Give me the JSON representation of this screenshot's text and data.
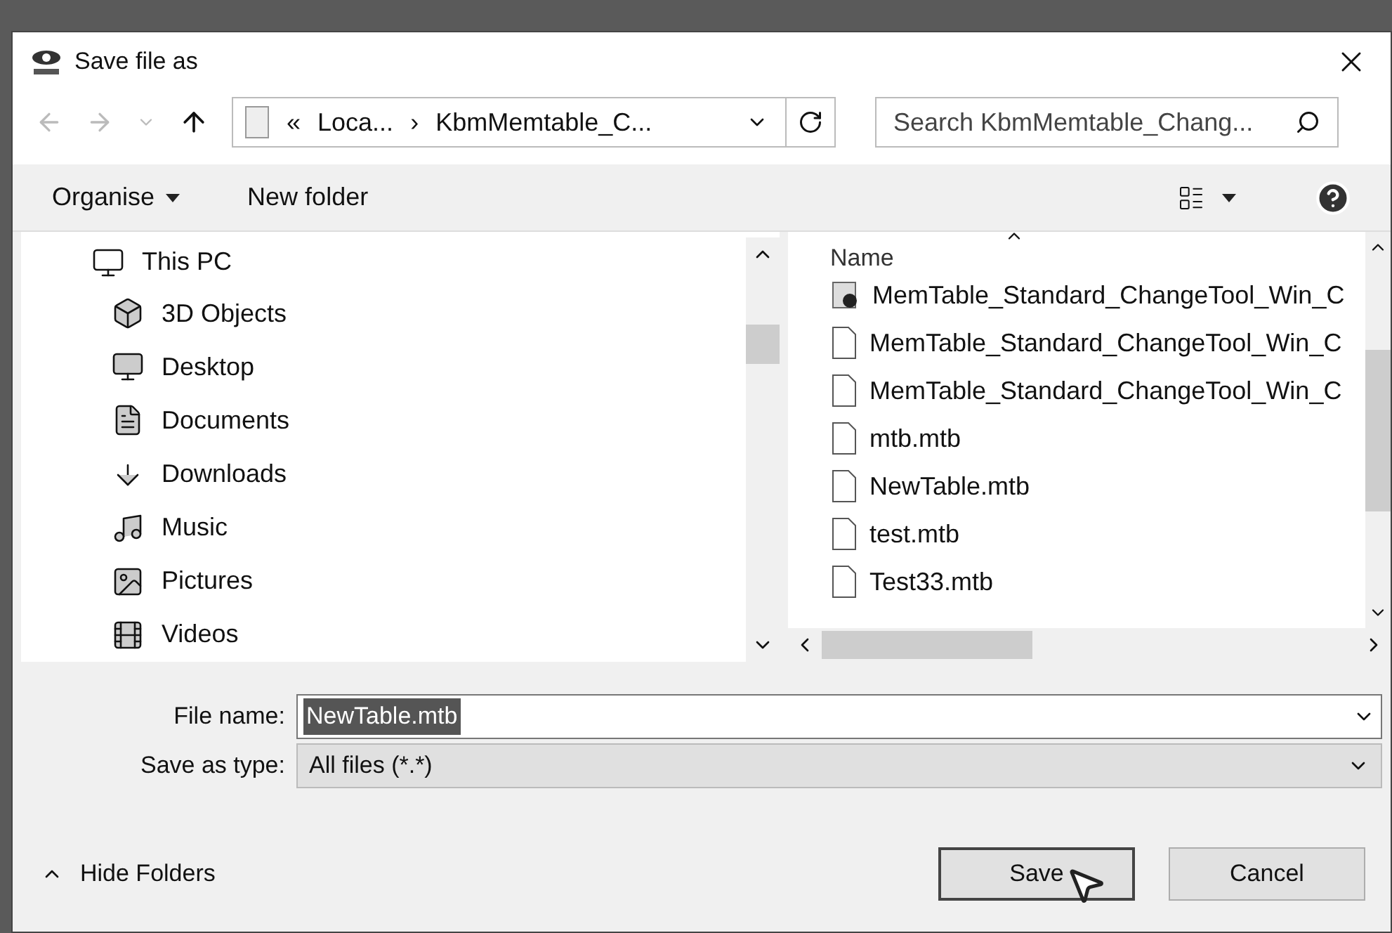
{
  "window": {
    "title": "Save file as"
  },
  "address_bar": {
    "crumbs": [
      "«",
      "Loca...",
      "›",
      "KbmMemtable_C..."
    ]
  },
  "search": {
    "placeholder": "Search KbmMemtable_Chang..."
  },
  "toolbar": {
    "organise": "Organise",
    "new_folder": "New folder"
  },
  "nav_tree": [
    {
      "label": "This PC",
      "children": [
        {
          "label": "3D Objects"
        },
        {
          "label": "Desktop"
        },
        {
          "label": "Documents"
        },
        {
          "label": "Downloads"
        },
        {
          "label": "Music"
        },
        {
          "label": "Pictures"
        },
        {
          "label": "Videos"
        }
      ]
    }
  ],
  "file_list": {
    "column": "Name",
    "files": [
      {
        "name": "MemTable_Standard_ChangeTool_Win_C",
        "kind": "image"
      },
      {
        "name": "MemTable_Standard_ChangeTool_Win_C",
        "kind": "document"
      },
      {
        "name": "MemTable_Standard_ChangeTool_Win_C",
        "kind": "document"
      },
      {
        "name": "mtb.mtb",
        "kind": "document"
      },
      {
        "name": "NewTable.mtb",
        "kind": "document"
      },
      {
        "name": "test.mtb",
        "kind": "document"
      },
      {
        "name": "Test33.mtb",
        "kind": "document"
      }
    ]
  },
  "file_name": {
    "label": "File name:",
    "value": "NewTable.mtb",
    "highlighted": true
  },
  "save_type": {
    "label": "Save as type:",
    "value": "All files (*.*)"
  },
  "hide_folders": "Hide Folders",
  "buttons": [
    {
      "label": "Save",
      "default": true
    },
    {
      "label": "Cancel",
      "default": false
    }
  ]
}
